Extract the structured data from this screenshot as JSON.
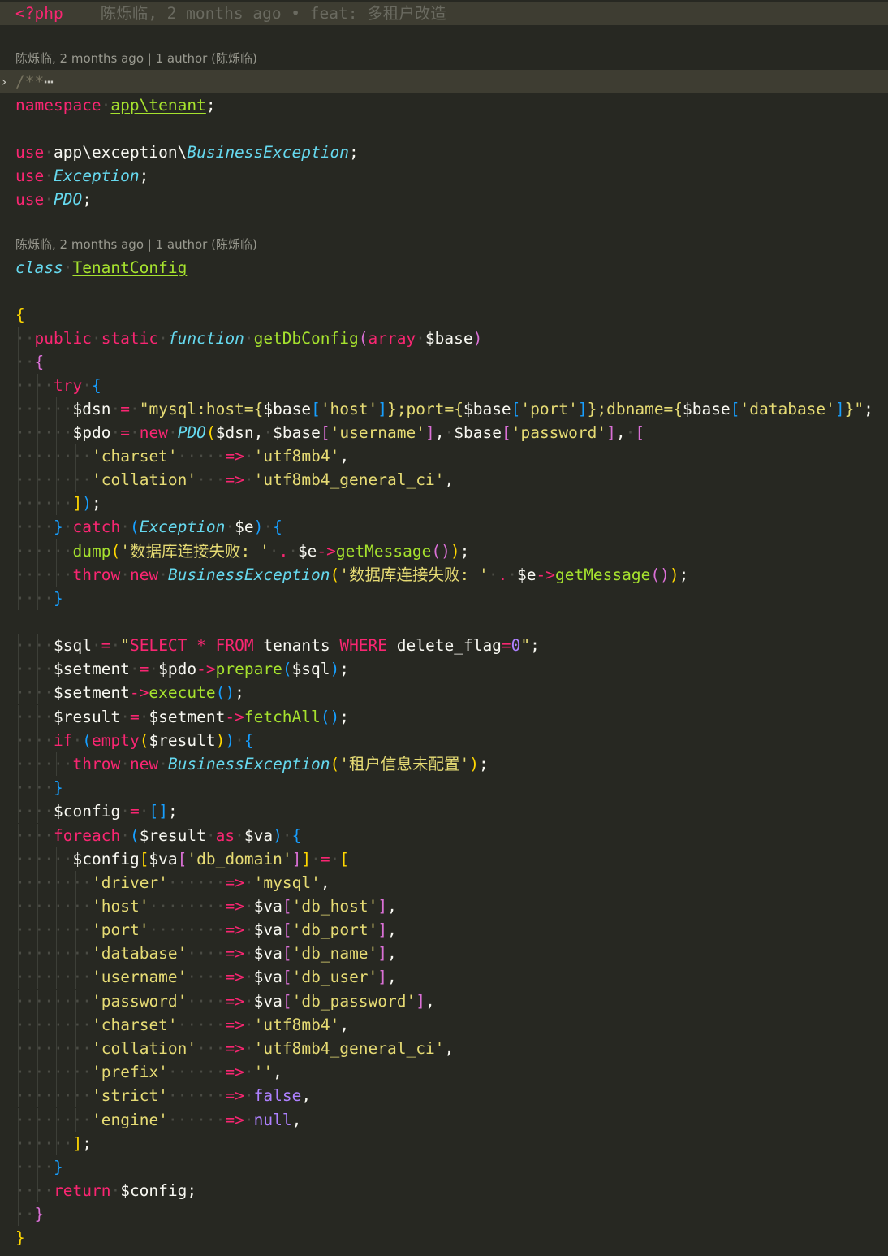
{
  "editor": {
    "language": "php",
    "theme_colors": {
      "background": "#272822",
      "current_line": "#3E3D32",
      "keyword": "#F92672",
      "type": "#66D9EF",
      "function": "#A6E22E",
      "string": "#E6DB74",
      "constant": "#AE81FF",
      "comment": "#75715E",
      "bracket_level1": "#FFD700",
      "bracket_level2": "#DA70D6",
      "bracket_level3": "#179FFF"
    },
    "inline_blame": "陈烁临, 2 months ago • feat: 多租户改造",
    "codelens": [
      "陈烁临, 2 months ago | 1 author (陈烁临)",
      "陈烁临, 2 months ago | 1 author (陈烁临)"
    ],
    "folded_block_text": "/**",
    "fold_icon": "chevron-right-icon",
    "lines": [
      "<?php",
      "/**",
      "namespace app\\tenant;",
      "",
      "use app\\exception\\BusinessException;",
      "use Exception;",
      "use PDO;",
      "class TenantConfig",
      "",
      "{",
      "public static function getDbConfig(array $base)",
      "{",
      "try {",
      "$dsn = \"mysql:host={$base['host']};port={$base['port']};dbname={$base['database']}\";",
      "$pdo = new PDO($dsn, $base['username'], $base['password'], [",
      "'charset'     => 'utf8mb4',",
      "'collation'   => 'utf8mb4_general_ci',",
      "]);",
      "} catch (Exception $e) {",
      "dump('数据库连接失败: ' . $e->getMessage());",
      "throw new BusinessException('数据库连接失败: ' . $e->getMessage());",
      "}",
      "",
      "$sql = \"SELECT * FROM tenants WHERE delete_flag=0\";",
      "$setment = $pdo->prepare($sql);",
      "$setment->execute();",
      "$result = $setment->fetchAll();",
      "if (empty($result)) {",
      "throw new BusinessException('租户信息未配置');",
      "}",
      "$config = [];",
      "foreach ($result as $va) {",
      "$config[$va['db_domain']] = [",
      "'driver'      => 'mysql',",
      "'host'        => $va['db_host'],",
      "'port'        => $va['db_port'],",
      "'database'    => $va['db_name'],",
      "'username'    => $va['db_user'],",
      "'password'    => $va['db_password'],",
      "'charset'     => 'utf8mb4',",
      "'collation'   => 'utf8mb4_general_ci',",
      "'prefix'      => '',",
      "'strict'      => false,",
      "'engine'      => null,",
      "];",
      "}",
      "return $config;",
      "}",
      "}"
    ]
  }
}
